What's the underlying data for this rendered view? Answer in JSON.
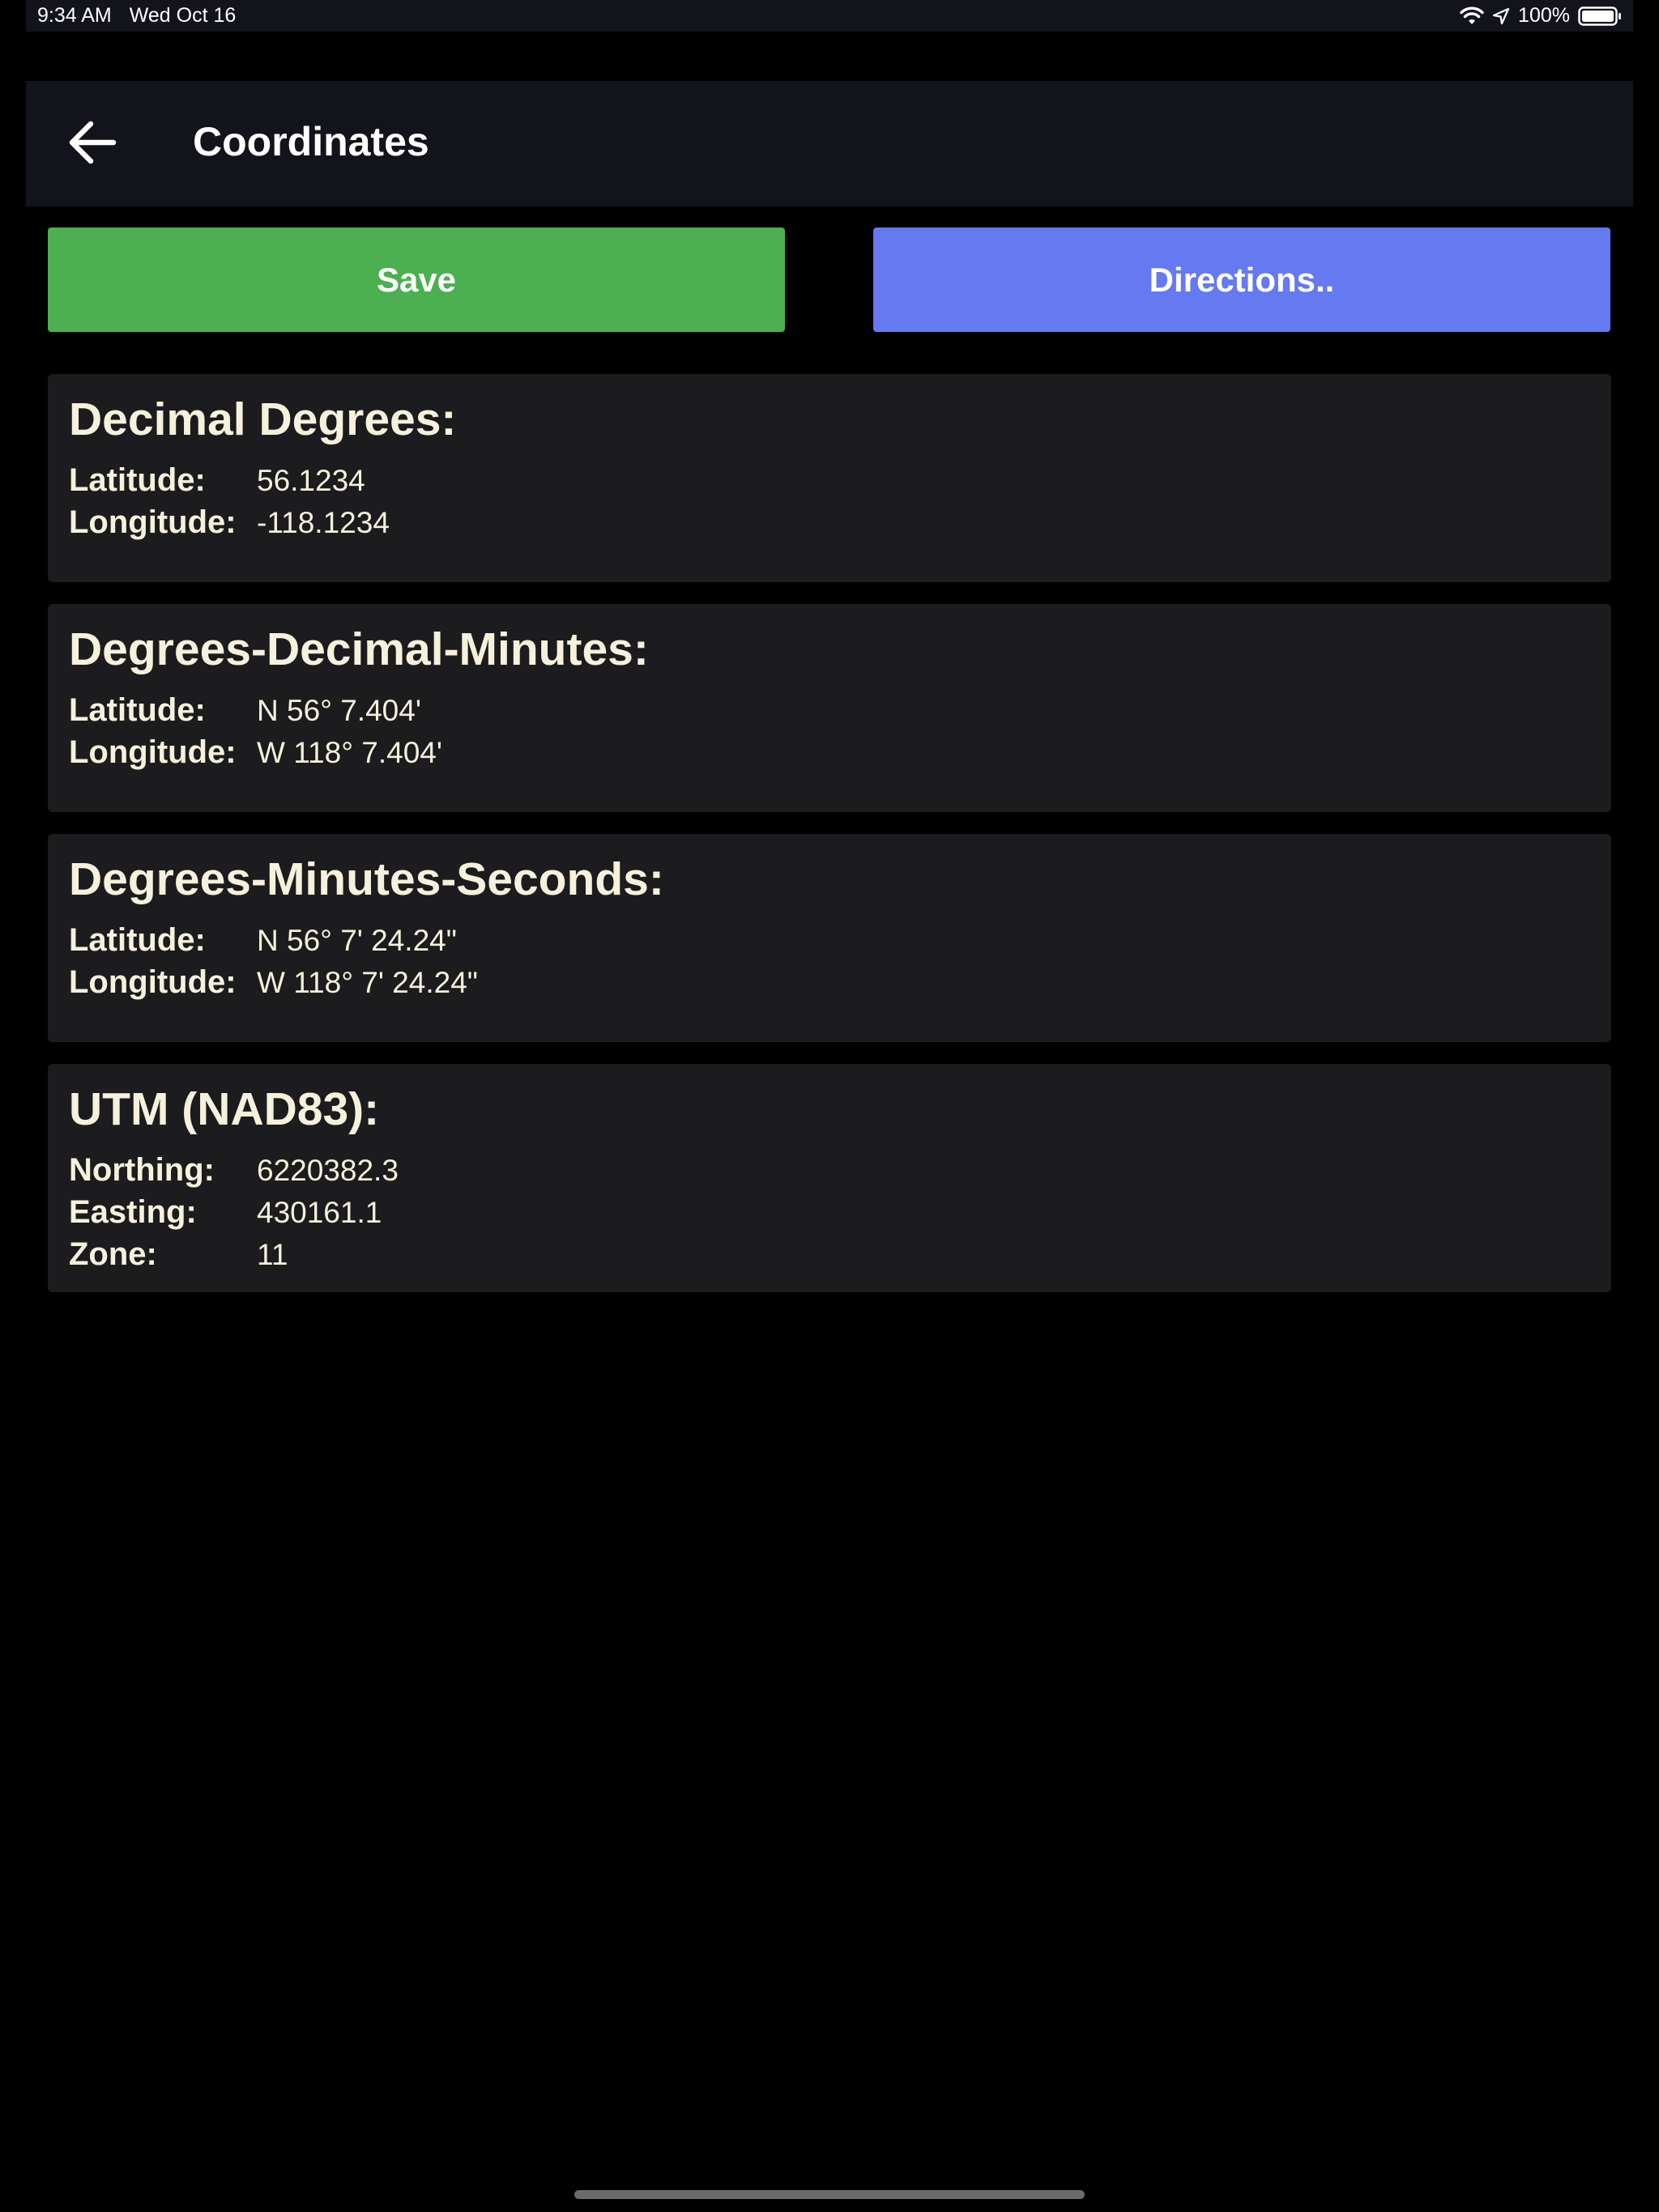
{
  "status_bar": {
    "time": "9:34 AM",
    "date": "Wed Oct 16",
    "battery": "100%",
    "icons": [
      "wifi-icon",
      "location-icon",
      "battery-icon"
    ]
  },
  "header": {
    "back_icon": "arrow-left-icon",
    "title": "Coordinates"
  },
  "actions": {
    "save_label": "Save",
    "directions_label": "Directions.."
  },
  "colors": {
    "save": "#4caf50",
    "directions": "#6579f0",
    "header_bg": "#13131c",
    "card_bg": "#1c1c1e",
    "text": "#f5f1dc"
  },
  "sections": [
    {
      "title": "Decimal Degrees:",
      "rows": [
        {
          "label": "Latitude:",
          "value": "56.1234"
        },
        {
          "label": "Longitude:",
          "value": "-118.1234"
        }
      ]
    },
    {
      "title": "Degrees-Decimal-Minutes:",
      "rows": [
        {
          "label": "Latitude:",
          "value": "N 56° 7.404'"
        },
        {
          "label": "Longitude:",
          "value": "W 118° 7.404'"
        }
      ]
    },
    {
      "title": "Degrees-Minutes-Seconds:",
      "rows": [
        {
          "label": "Latitude:",
          "value": "N 56° 7' 24.24\""
        },
        {
          "label": "Longitude:",
          "value": "W 118° 7' 24.24\""
        }
      ]
    },
    {
      "title": "UTM (NAD83):",
      "rows": [
        {
          "label": "Northing:",
          "value": "6220382.3"
        },
        {
          "label": "Easting:",
          "value": "430161.1"
        },
        {
          "label": "Zone:",
          "value": "11"
        }
      ]
    }
  ]
}
